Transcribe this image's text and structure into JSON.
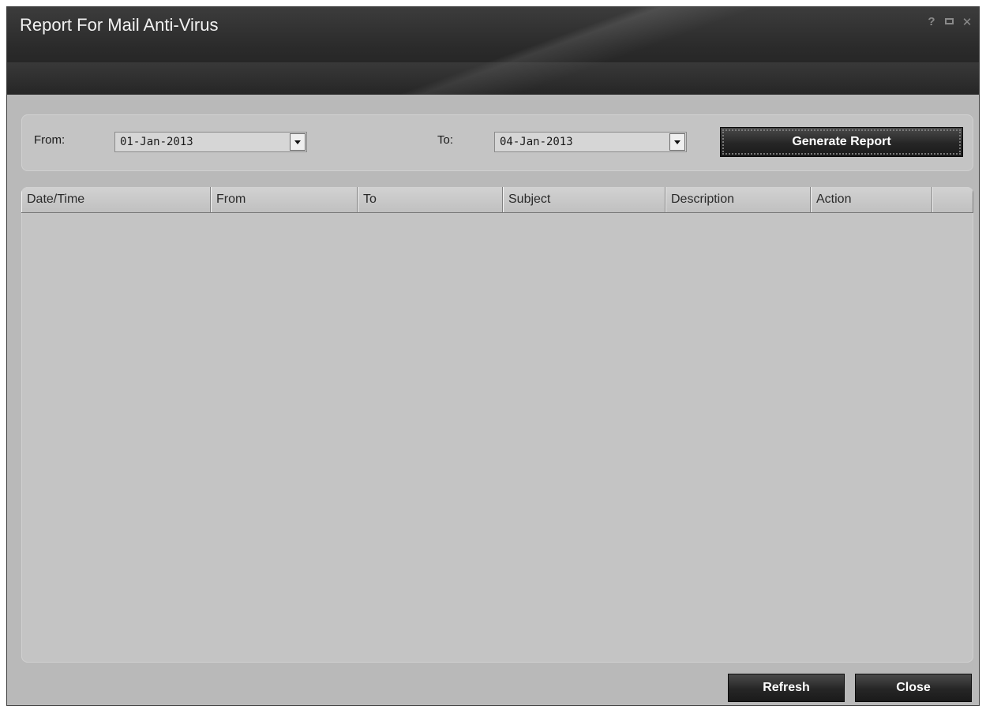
{
  "window": {
    "title": "Report For Mail Anti-Virus",
    "controls": {
      "help": "?",
      "close": "✕"
    }
  },
  "filter": {
    "from_label": "From:",
    "from_value": "01-Jan-2013",
    "to_label": "To:",
    "to_value": "04-Jan-2013",
    "generate_label": "Generate Report"
  },
  "table": {
    "columns": [
      "Date/Time",
      "From",
      "To",
      "Subject",
      "Description",
      "Action"
    ],
    "rows": []
  },
  "footer": {
    "refresh_label": "Refresh",
    "close_label": "Close"
  }
}
